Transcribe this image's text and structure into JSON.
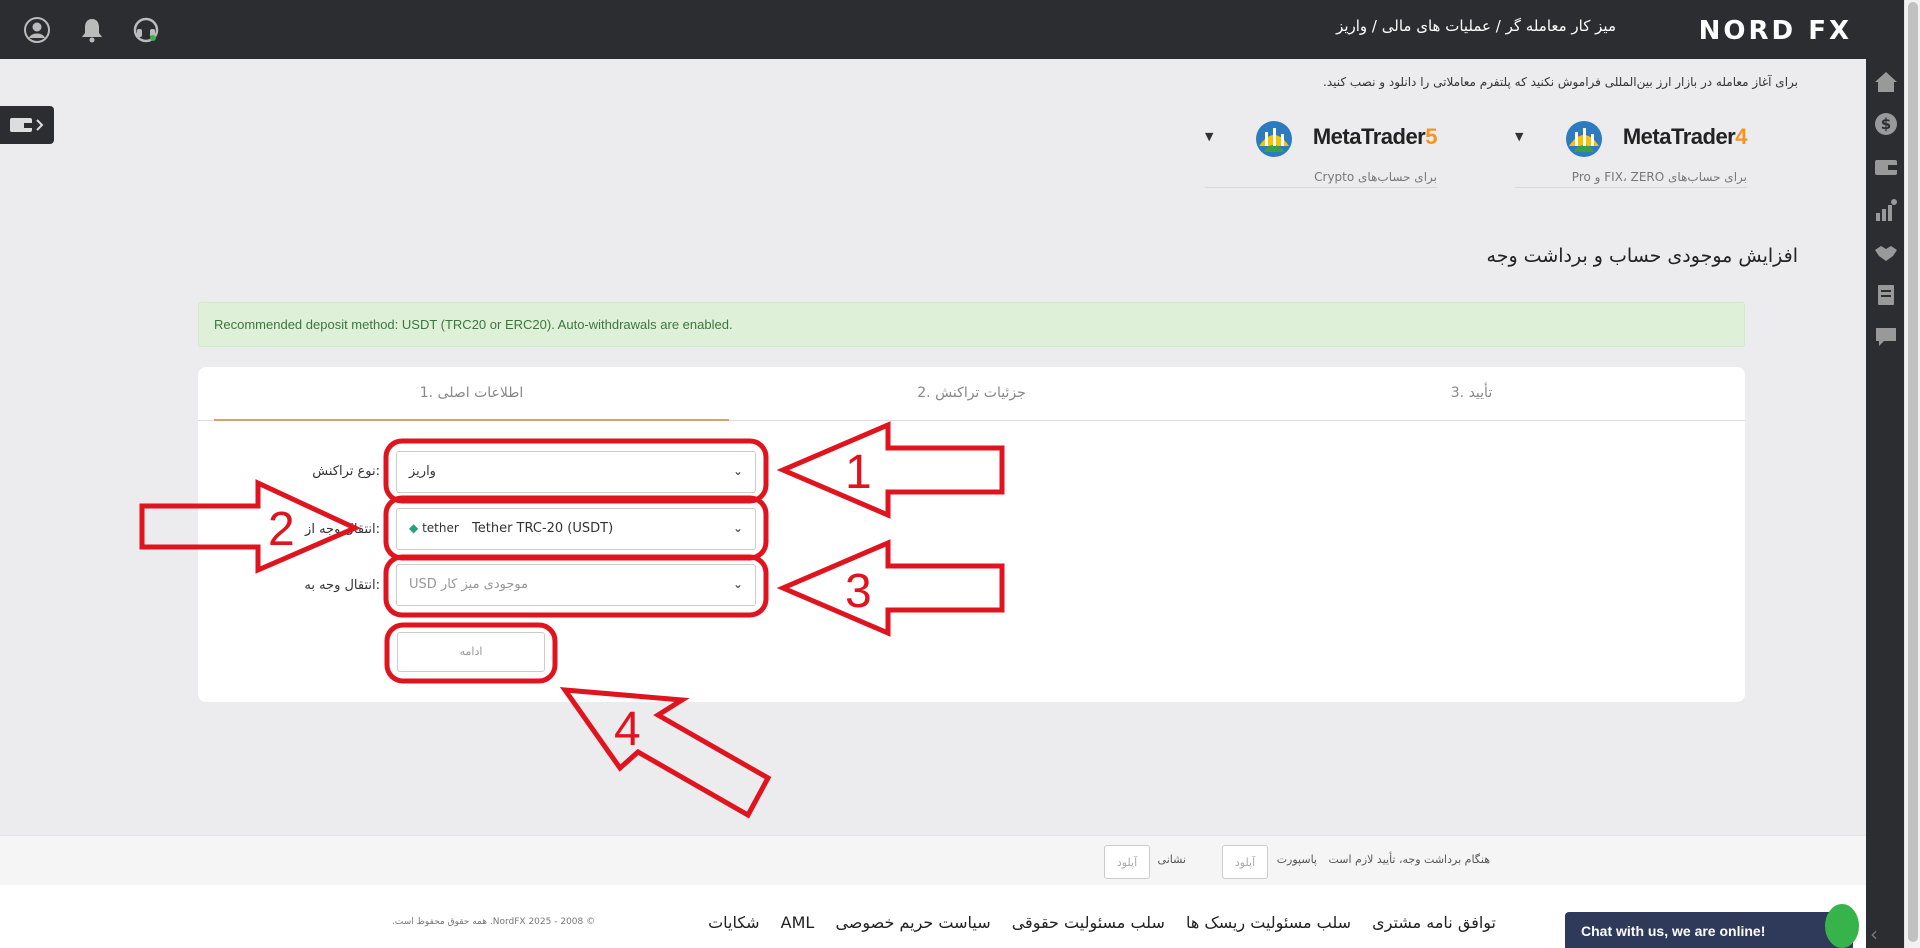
{
  "header": {
    "brand": "NORD FX",
    "breadcrumb": "میز کار معامله گر / عملیات های مالی / واریز"
  },
  "notice": "برای آغاز معامله در بازار ارز بین‌المللی فراموش نکنید که پلتفرم معاملاتی را دانلود و نصب کنید.",
  "platforms": [
    {
      "name": "MetaTrader",
      "version": "4",
      "caption": "برای حساب‌های FIX، ZERO و Pro"
    },
    {
      "name": "MetaTrader",
      "version": "5",
      "caption": "برای حساب‌های Crypto"
    }
  ],
  "section_title": "افزایش موجودی حساب و برداشت وجه",
  "alert": "Recommended deposit method: USDT (TRC20 or ERC20). Auto-withdrawals are enabled.",
  "steps": [
    "1. اطلاعات اصلی",
    "2. جزئیات تراکنش",
    "3. تأیید"
  ],
  "form": {
    "transaction_type_label": ":نوع تراکنش",
    "transaction_type_value": "واریز",
    "transfer_from_label": ":انتقال وجه از",
    "transfer_from_brand": "tether",
    "transfer_from_value": "Tether TRC-20 (USDT)",
    "transfer_to_label": ":انتقال وجه به",
    "transfer_to_value": "USD موجودی میز کار",
    "continue_label": "ادامه"
  },
  "annotations": [
    "1",
    "2",
    "3",
    "4"
  ],
  "verification": {
    "note": "هنگام برداشت وجه، تأیید لازم است",
    "passport_label": "پاسپورت",
    "address_label": "نشانی",
    "upload_label": "آپلود"
  },
  "footer": {
    "links": [
      "توافق نامه مشتری",
      "سلب مسئولیت ریسک ها",
      "سلب مسئولیت حقوقی",
      "سیاست حریم خصوصی",
      "AML",
      "شکایات"
    ],
    "copyright": "© 2008 - 2025 NordFX. همه حقوق محفوظ است.",
    "chat": "Chat with us, we are online!"
  },
  "colors": {
    "topbar": "#2b2d31",
    "accent_orange": "#f7941d",
    "brand_green": "#8cc63f",
    "annotation_red": "#e0141e",
    "alert_bg": "#dff0d8"
  },
  "icons": [
    "user-icon",
    "bell-icon",
    "support-icon",
    "home-icon",
    "dollar-icon",
    "wallet-icon",
    "chart-icon",
    "handshake-icon",
    "document-icon",
    "chat-icon"
  ]
}
